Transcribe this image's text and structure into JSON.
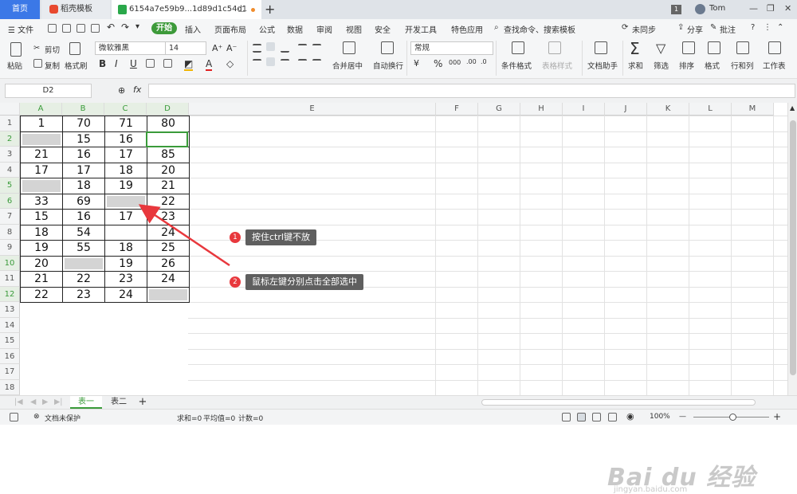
{
  "titlebar": {
    "home_tab": "首页",
    "shell_tab": "稻壳模板",
    "file_tab": "6154a7e59b9...1d89d1c54d1",
    "badge": "1",
    "user": "Tom",
    "win_min": "—",
    "win_restore": "❐",
    "win_close": "✕"
  },
  "menu": {
    "file": "☰ 文件",
    "start": "开始",
    "insert": "插入",
    "page_layout": "页面布局",
    "formula": "公式",
    "data": "数据",
    "review": "审阅",
    "view": "视图",
    "security": "安全",
    "developer": "开发工具",
    "special": "特色应用",
    "search": "查找命令、搜索模板",
    "unsynced": "未同步",
    "share": "分享",
    "annotate": "批注",
    "help": "?"
  },
  "ribbon": {
    "paste": "粘贴",
    "cut": "剪切",
    "copy": "复制",
    "format_painter": "格式刷",
    "font_name": "微软雅黑",
    "font_size": "14",
    "bold": "B",
    "italic": "I",
    "underline": "U",
    "merge_center": "合并居中",
    "wrap_text": "自动换行",
    "number_format": "常规",
    "percent": "%",
    "thousands": "000",
    "cond_format": "条件格式",
    "table_style": "表格样式",
    "doc_helper": "文档助手",
    "sum": "求和",
    "filter": "筛选",
    "sort": "排序",
    "format": "格式",
    "row_col": "行和列",
    "worksheet": "工作表"
  },
  "formula_bar": {
    "name_box": "D2",
    "fx": "fx"
  },
  "columns": [
    "A",
    "B",
    "C",
    "D",
    "E",
    "F",
    "G",
    "H",
    "I",
    "J",
    "K",
    "L",
    "M"
  ],
  "rows": [
    "1",
    "2",
    "3",
    "4",
    "5",
    "6",
    "7",
    "8",
    "9",
    "10",
    "11",
    "12",
    "13",
    "14",
    "15",
    "16",
    "17",
    "18"
  ],
  "grid": [
    [
      "1",
      "70",
      "71",
      "80"
    ],
    [
      "",
      "15",
      "16",
      ""
    ],
    [
      "21",
      "16",
      "17",
      "85"
    ],
    [
      "17",
      "17",
      "18",
      "20"
    ],
    [
      "",
      "18",
      "19",
      "21"
    ],
    [
      "33",
      "69",
      "",
      "22"
    ],
    [
      "15",
      "16",
      "17",
      "23"
    ],
    [
      "18",
      "54",
      "",
      "24"
    ],
    [
      "19",
      "55",
      "18",
      "25"
    ],
    [
      "20",
      "",
      "19",
      "26"
    ],
    [
      "21",
      "22",
      "23",
      "24"
    ],
    [
      "22",
      "23",
      "24",
      ""
    ]
  ],
  "gray_cells": [
    [
      1,
      0
    ],
    [
      4,
      0
    ],
    [
      5,
      2
    ],
    [
      9,
      1
    ],
    [
      11,
      3
    ]
  ],
  "annotations": {
    "step1_num": "1",
    "step1_text": "按住ctrl键不放",
    "step2_num": "2",
    "step2_text": "鼠标左键分别点击全部选中"
  },
  "sheets": {
    "sheet1": "表一",
    "sheet2": "表二",
    "add": "+"
  },
  "status": {
    "protect": "文档未保护",
    "sum": "求和=0",
    "avg": "平均值=0",
    "count": "计数=0",
    "zoom": "100%",
    "zoom_minus": "—",
    "zoom_plus": "+"
  },
  "watermark": {
    "brand": "Bai du 经验",
    "url": "jingyan.baidu.com"
  },
  "colors": {
    "accent_green": "#3a9b3a",
    "tab_blue": "#3b78e7",
    "callout_bg": "#5f5f5f",
    "badge_red": "#e8383d",
    "arrow_red": "#e8383d",
    "gray_fill": "#d4d4d4"
  }
}
